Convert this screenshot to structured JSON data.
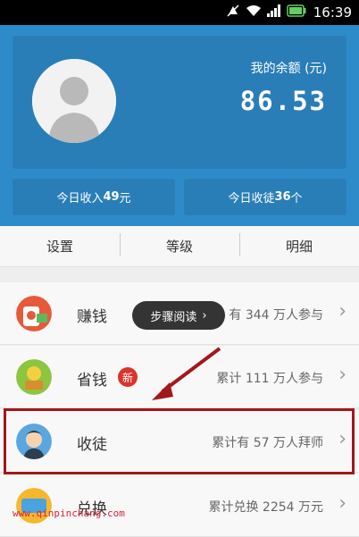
{
  "status_bar": {
    "time": "16:39"
  },
  "account": {
    "balance_label": "我的余额 (元)",
    "balance_value": "86.53",
    "stat_income_prefix": "今日收入",
    "stat_income_value": "49",
    "stat_income_suffix": "元",
    "stat_apprentice_prefix": "今日收徒",
    "stat_apprentice_value": "36",
    "stat_apprentice_suffix": "个"
  },
  "tabs": [
    {
      "label": "设置"
    },
    {
      "label": "等级"
    },
    {
      "label": "明细"
    }
  ],
  "menu": [
    {
      "title": "赚钱",
      "desc": "有 344 万人参与"
    },
    {
      "title": "省钱",
      "badge": "新",
      "desc": "累计 111 万人参与"
    },
    {
      "title": "收徒",
      "desc": "累计有 57 万人拜师"
    },
    {
      "title": "兑换",
      "desc": "累计兑换 2254 万元"
    }
  ],
  "tooltip": {
    "label": "步骤阅读"
  },
  "watermark": {
    "text": "www.qinpinchang.com"
  },
  "icons": {
    "signal": "signal-icon",
    "wifi": "wifi-icon",
    "battery": "battery-icon",
    "mute": "mute-icon",
    "avatar": "avatar-placeholder-icon"
  },
  "colors": {
    "header_bg": "#2e8bc9",
    "card_bg": "#2a7eb8",
    "highlight": "#a3171b",
    "badge": "#d9342b"
  }
}
